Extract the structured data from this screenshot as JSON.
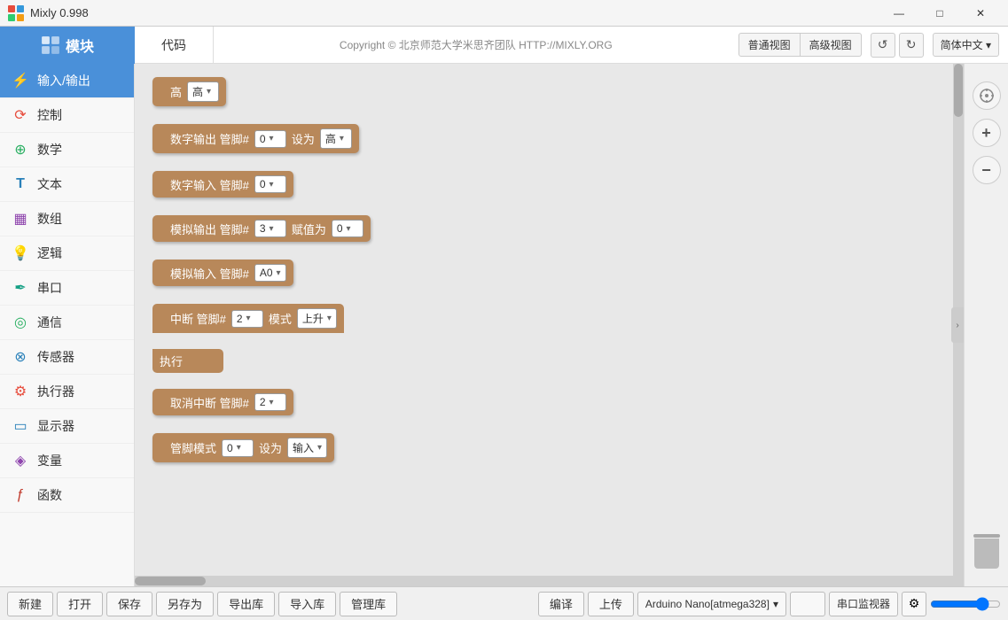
{
  "titlebar": {
    "title": "Mixly 0.998",
    "minimize": "—",
    "maximize": "□",
    "close": "✕"
  },
  "header": {
    "logo": "模块",
    "tab_blocks": "代码",
    "copyright": "Copyright © 北京师范大学米思齐团队 HTTP://MIXLY.ORG",
    "view_normal": "普通视图",
    "view_advanced": "高级视图",
    "undo": "↺",
    "redo": "↻",
    "lang": "简体中文 ▾"
  },
  "sidebar": {
    "items": [
      {
        "label": "输入/输出",
        "icon": "⚡",
        "active": true
      },
      {
        "label": "控制",
        "icon": "🔄"
      },
      {
        "label": "数学",
        "icon": "🔵"
      },
      {
        "label": "文本",
        "icon": "T"
      },
      {
        "label": "数组",
        "icon": "▦"
      },
      {
        "label": "逻辑",
        "icon": "💡"
      },
      {
        "label": "串口",
        "icon": "✒"
      },
      {
        "label": "通信",
        "icon": "📡"
      },
      {
        "label": "传感器",
        "icon": "🌡"
      },
      {
        "label": "执行器",
        "icon": "⚙"
      },
      {
        "label": "显示器",
        "icon": "🖥"
      },
      {
        "label": "变量",
        "icon": "📊"
      },
      {
        "label": "函数",
        "icon": "ƒ"
      }
    ]
  },
  "blocks": [
    {
      "type": "simple",
      "label": "高",
      "dropdown": "高"
    },
    {
      "type": "digital_out",
      "label": "数字输出 管脚#",
      "pin": "0",
      "value_label": "设为",
      "value": "高"
    },
    {
      "type": "digital_in",
      "label": "数字输入 管脚#",
      "pin": "0"
    },
    {
      "type": "analog_out",
      "label": "模拟输出 管脚#",
      "pin": "3",
      "value_label": "赋值为",
      "value": "0"
    },
    {
      "type": "analog_in",
      "label": "模拟输入 管脚#",
      "pin": "A0"
    },
    {
      "type": "interrupt",
      "label": "中断 管脚#",
      "pin": "2",
      "mode_label": "模式",
      "mode": "上升",
      "exec_label": "执行"
    },
    {
      "type": "cancel_interrupt",
      "label": "取消中断 管脚#",
      "pin": "2"
    },
    {
      "type": "pin_mode",
      "label": "管脚模式",
      "pin": "0",
      "value_label": "设为",
      "value": "输入"
    }
  ],
  "bottom": {
    "new": "新建",
    "open": "打开",
    "save": "保存",
    "save_as": "另存为",
    "export_lib": "导出库",
    "import_lib": "导入库",
    "manage_lib": "管理库",
    "compile": "编译",
    "upload": "上传",
    "board": "Arduino Nano[atmega328]",
    "serial_monitor": "串口监视器"
  }
}
